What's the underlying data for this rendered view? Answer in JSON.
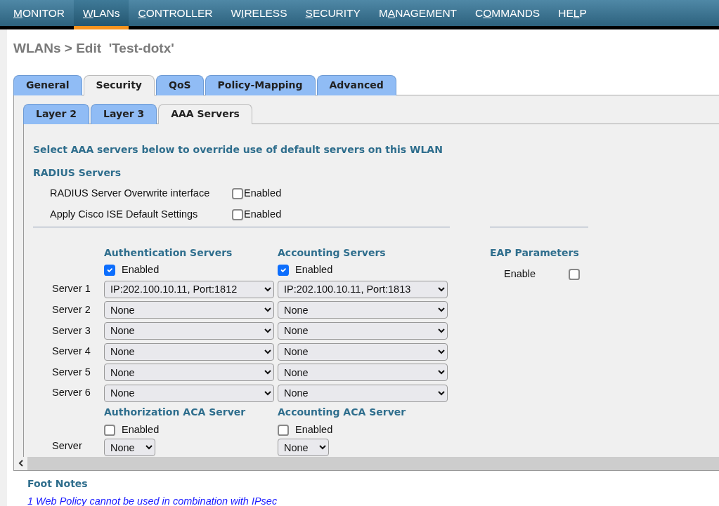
{
  "nav": [
    {
      "label": [
        {
          "text": "M",
          "underline": true
        },
        {
          "text": "ONITOR",
          "underline": false
        }
      ],
      "selected": false
    },
    {
      "label": [
        {
          "text": "W",
          "underline": true
        },
        {
          "text": "LANs",
          "underline": false
        }
      ],
      "selected": true
    },
    {
      "label": [
        {
          "text": "C",
          "underline": true
        },
        {
          "text": "ONTROLLER",
          "underline": false
        }
      ],
      "selected": false
    },
    {
      "label": [
        {
          "text": "W",
          "underline": false
        },
        {
          "text": "I",
          "underline": true
        },
        {
          "text": "RELESS",
          "underline": false
        }
      ],
      "selected": false
    },
    {
      "label": [
        {
          "text": "S",
          "underline": true
        },
        {
          "text": "ECURITY",
          "underline": false
        }
      ],
      "selected": false
    },
    {
      "label": [
        {
          "text": "M",
          "underline": false
        },
        {
          "text": "A",
          "underline": true
        },
        {
          "text": "NAGEMENT",
          "underline": false
        }
      ],
      "selected": false
    },
    {
      "label": [
        {
          "text": "C",
          "underline": false
        },
        {
          "text": "O",
          "underline": true
        },
        {
          "text": "MMANDS",
          "underline": false
        }
      ],
      "selected": false
    },
    {
      "label": [
        {
          "text": "HE",
          "underline": false
        },
        {
          "text": "L",
          "underline": true
        },
        {
          "text": "P",
          "underline": false
        }
      ],
      "selected": false
    }
  ],
  "page_title": "WLANs > Edit  'Test-dotx'",
  "tabs": [
    {
      "label": "General",
      "selected": false
    },
    {
      "label": "Security",
      "selected": true
    },
    {
      "label": "QoS",
      "selected": false
    },
    {
      "label": "Policy-Mapping",
      "selected": false
    },
    {
      "label": "Advanced",
      "selected": false
    }
  ],
  "subtabs": [
    {
      "label": "Layer 2",
      "selected": false
    },
    {
      "label": "Layer 3",
      "selected": false
    },
    {
      "label": "AAA Servers",
      "selected": true
    }
  ],
  "intro": "Select AAA servers below to override use of default servers on this WLAN",
  "radius_heading": "RADIUS Servers",
  "radius_options": [
    {
      "label": "RADIUS Server Overwrite interface",
      "option": "Enabled",
      "checked": false
    },
    {
      "label": "Apply Cisco ISE Default Settings",
      "option": "Enabled",
      "checked": false
    }
  ],
  "auth_servers": {
    "heading": "Authentication Servers",
    "enabled_label": "Enabled",
    "checked": true
  },
  "acct_servers": {
    "heading": "Accounting Servers",
    "enabled_label": "Enabled",
    "checked": true
  },
  "servers": [
    {
      "label": "Server 1",
      "auth": "IP:202.100.10.11, Port:1812",
      "acct": "IP:202.100.10.11, Port:1813"
    },
    {
      "label": "Server 2",
      "auth": "None",
      "acct": "None"
    },
    {
      "label": "Server 3",
      "auth": "None",
      "acct": "None"
    },
    {
      "label": "Server 4",
      "auth": "None",
      "acct": "None"
    },
    {
      "label": "Server 5",
      "auth": "None",
      "acct": "None"
    },
    {
      "label": "Server 6",
      "auth": "None",
      "acct": "None"
    }
  ],
  "eap": {
    "heading": "EAP Parameters",
    "label": "Enable",
    "checked": false
  },
  "aca": {
    "auth": {
      "heading": "Authorization ACA Server",
      "enabled_label": "Enabled",
      "checked": false
    },
    "acct": {
      "heading": "Accounting ACA Server",
      "enabled_label": "Enabled",
      "checked": false
    },
    "row_label": "Server",
    "auth_value": "None",
    "acct_value": "None"
  },
  "footnotes": {
    "heading": "Foot Notes",
    "items": [
      "1 Web Policy cannot be used in combination with IPsec"
    ]
  }
}
